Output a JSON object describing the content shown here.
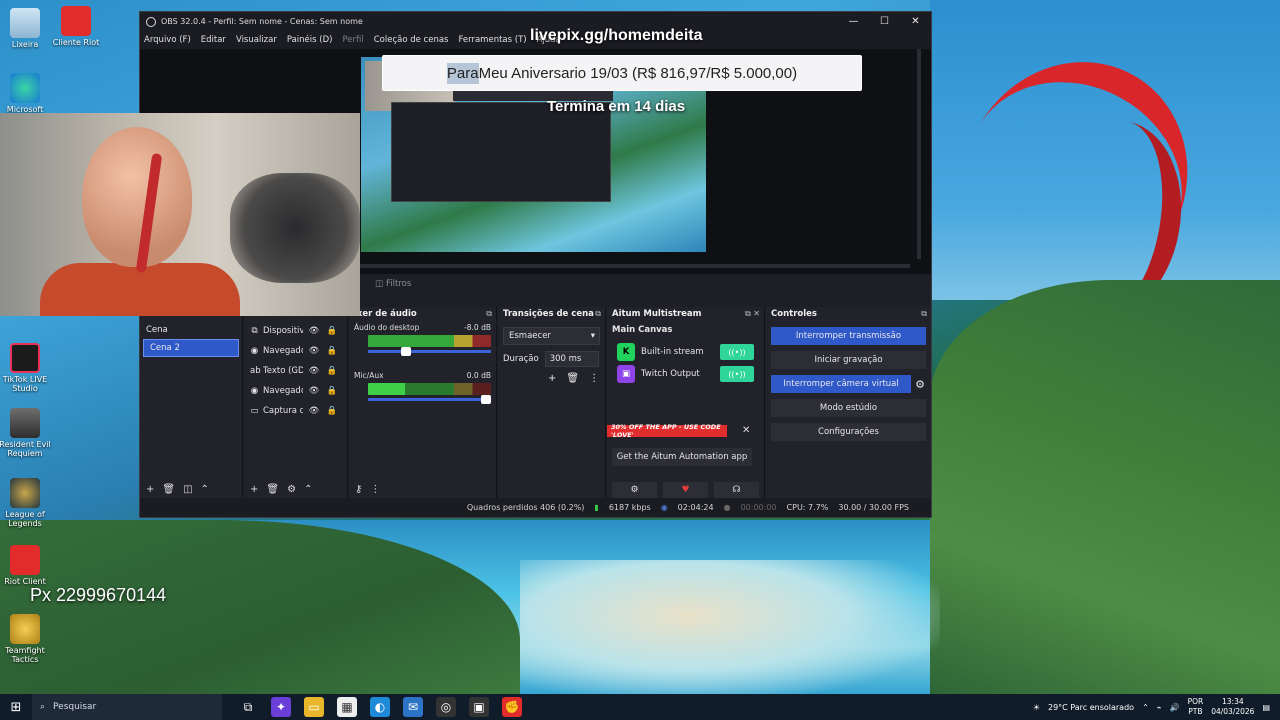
{
  "desktop": {
    "icons": [
      {
        "label": "Lixeira"
      },
      {
        "label": "Cliente Riot"
      },
      {
        "label": "Microsoft"
      },
      {
        "label": "TikTok LIVE Studio"
      },
      {
        "label": "Resident Evil Requiem"
      },
      {
        "label": "League of Legends"
      },
      {
        "label": "Riot Client"
      },
      {
        "label": "Teamfight Tactics"
      }
    ],
    "px_text": "Px 22999670144"
  },
  "overlay": {
    "title": "livepix.gg/homemdeita",
    "goal_prefix": "Para ",
    "goal_text": "Meu Aniversario 19/03 (R$ 816,97/R$ 5.000,00)",
    "countdown": "Termina em 14 dias"
  },
  "obs": {
    "title": "OBS 32.0.4 - Perfil: Sem nome - Cenas: Sem nome",
    "menu": [
      "Arquivo (F)",
      "Editar",
      "Visualizar",
      "Painéis (D)",
      "Perfil",
      "Coleção de cenas",
      "Ferramentas (T)",
      "Ajuda"
    ],
    "filters_label": "Filtros",
    "scenes": {
      "items": [
        "Cena",
        "Cena 2"
      ]
    },
    "sources": {
      "items": [
        {
          "icon": "⧉",
          "name": "Dispositiv"
        },
        {
          "icon": "◉",
          "name": "Navegadc"
        },
        {
          "icon": "ab",
          "name": "Texto (GD"
        },
        {
          "icon": "◉",
          "name": "Navegadc"
        },
        {
          "icon": "▭",
          "name": "Captura d"
        }
      ]
    },
    "mixer": {
      "title": "ixer de áudio",
      "channels": [
        {
          "name": "Áudio do desktop",
          "db": "-8.0 dB",
          "level": 0.35
        },
        {
          "name": "Mic/Aux",
          "db": "0.0 dB",
          "level": 1.0
        }
      ]
    },
    "transitions": {
      "title": "Transições de cena",
      "selected": "Esmaecer",
      "duration_label": "Duração",
      "duration_value": "300 ms"
    },
    "aitum": {
      "title": "Aitum Multistream",
      "main_canvas": "Main Canvas",
      "outputs": [
        {
          "name": "Built-in stream",
          "logo": "K",
          "color": "#1fd35c"
        },
        {
          "name": "Twitch Output",
          "logo": "▣",
          "color": "#8e44e8"
        }
      ],
      "promo": "30% OFF THE APP - USE CODE 'LOVE'",
      "app_button": "Get the Aitum Automation app"
    },
    "controls": {
      "title": "Controles",
      "buttons": [
        "Interromper transmissão",
        "Iniciar gravação",
        "Interromper câmera virtual",
        "Modo estúdio",
        "Configurações"
      ]
    },
    "status": {
      "dropped": "Quadros perdidos 406 (0.2%)",
      "bitrate": "6187 kbps",
      "stream_time": "02:04:24",
      "rec_time": "00:00:00",
      "cpu": "CPU: 7.7%",
      "fps": "30.00 / 30.00 FPS"
    }
  },
  "taskbar": {
    "search": "Pesquisar",
    "weather": "29°C  Parc ensolarado",
    "lang_top": "POR",
    "lang_bottom": "PTB",
    "time": "13:34",
    "date": "04/03/2026"
  }
}
